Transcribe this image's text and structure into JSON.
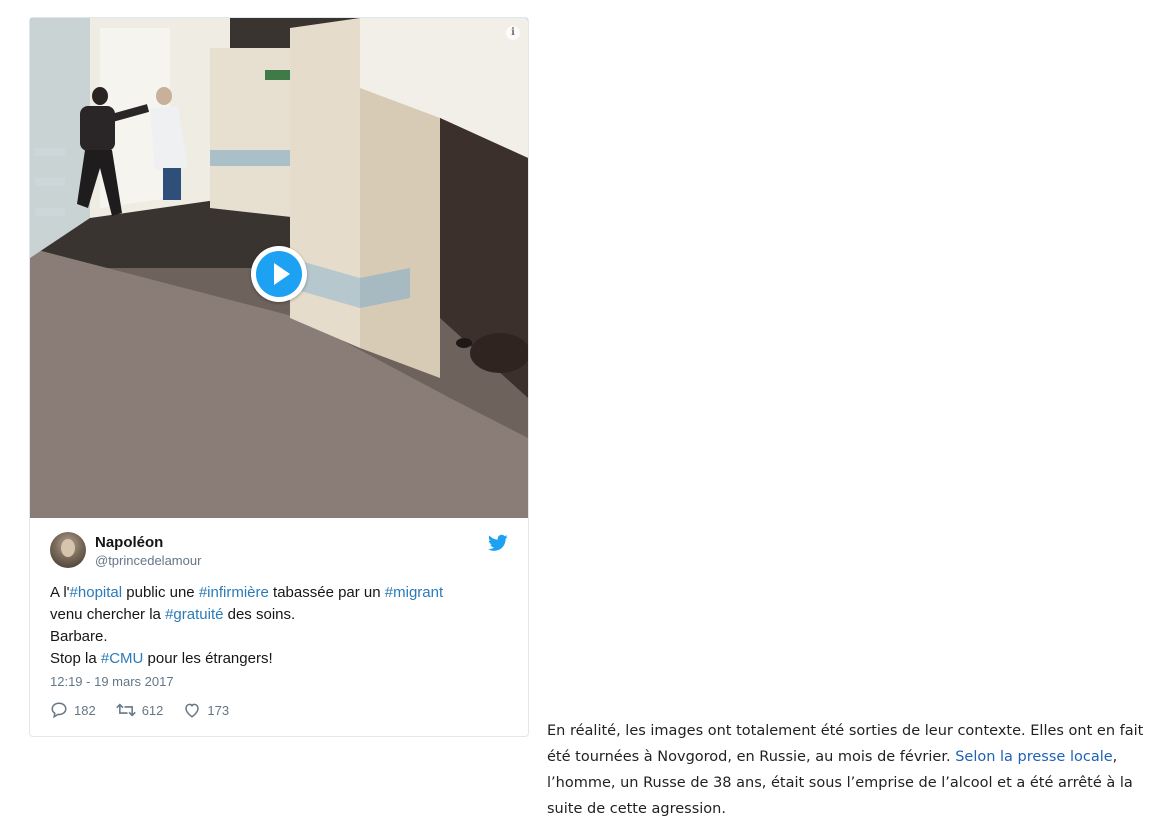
{
  "tweet": {
    "author_name": "Napoléon",
    "author_handle": "@tprincedelamour",
    "text_parts": [
      "A l'",
      "#hopital",
      " public une ",
      "#infirmière",
      " tabassée par un ",
      "#migrant",
      "venu chercher la ",
      "#gratuité",
      " des soins.",
      "Barbare.",
      "Stop la ",
      "#CMU",
      " pour les étrangers!"
    ],
    "timestamp": "12:19 - 19 mars 2017",
    "replies": "182",
    "retweets": "612",
    "likes": "173",
    "media_info_icon": "info-icon",
    "play_icon": "play-icon",
    "brand_icon": "twitter-bird-icon",
    "colors": {
      "link": "#2b7bb9",
      "brand": "#1da1f2",
      "muted": "#657786"
    }
  },
  "article": {
    "text_before_link": "En réalité, les images ont totalement été sorties de leur contexte. Elles ont en fait été tournées à Novgorod, en Russie, au mois de février. ",
    "link_text": "Selon la presse locale",
    "text_after_link": ", l’homme, un Russe de 38 ans, était sous l’emprise de l’alcool et a été arrêté à la suite de cette agression.",
    "link_color": "#1f62b6"
  }
}
